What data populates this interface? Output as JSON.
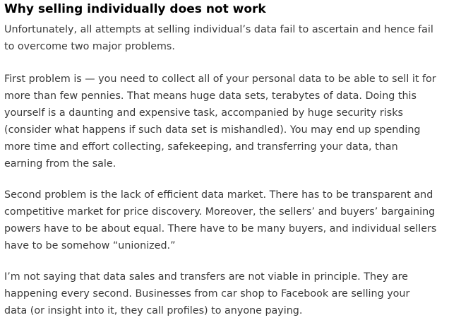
{
  "article": {
    "heading": "Why selling individually does not work",
    "paragraphs": [
      {
        "lines": [
          "Unfortunately, all attempts at selling individual’s data fail to ascertain and hence fail",
          "to overcome two major problems."
        ]
      },
      {
        "lines": [
          "First problem is — you need to collect all of your personal data to be able to sell it for",
          "more than few pennies. That means huge data sets, terabytes of data. Doing this",
          "yourself is a daunting and expensive task, accompanied by huge security risks",
          "(consider what happens if such data set is mishandled). You may end up spending",
          "more time and effort collecting, safekeeping, and transferring your data, than",
          "earning from the sale."
        ]
      },
      {
        "lines": [
          "Second problem is the lack of efficient data market. There has to be transparent and",
          "competitive market for price discovery. Moreover, the sellers’ and buyers’ bargaining",
          "powers have to be about equal. There have to be many buyers, and individual sellers",
          "have to be somehow “unionized.”"
        ]
      },
      {
        "lines": [
          "I’m not saying that data sales and transfers are not viable in principle. They are",
          "happening every second. Businesses from car shop to Facebook are selling your",
          "data (or insight into it, they call profiles) to anyone paying."
        ]
      }
    ]
  }
}
